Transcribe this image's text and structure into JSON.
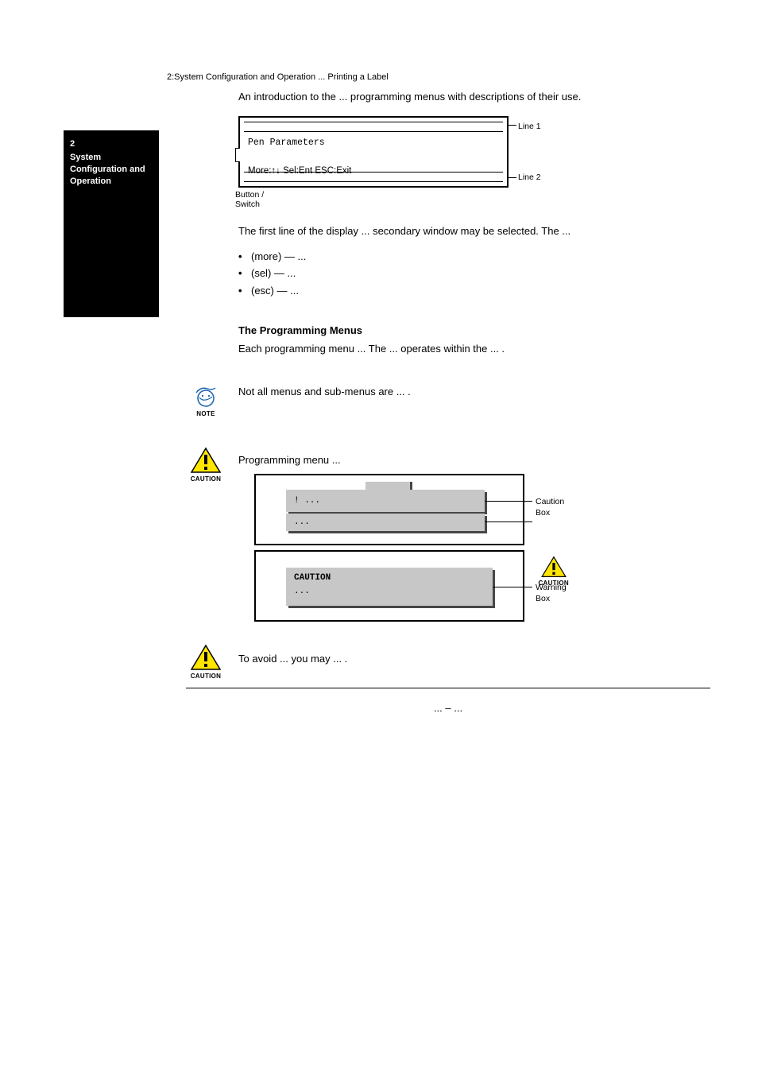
{
  "header_path": "2:System Configuration and Operation ... Printing a Label",
  "side_tab": {
    "line1": "2",
    "line2": "System Configuration and Operation"
  },
  "intro": "An introduction to the ... programming menus with descriptions of their use.",
  "lcd1": {
    "top_text": "Pen Parameters",
    "bottom_text": "More:↑↓  Sel:Ent  ESC:Exit",
    "callout_top": "Line 1",
    "callout_bottom": "Line 2",
    "callout_left": "Button / Switch"
  },
  "p_firstline": "The first line of the display ... secondary window may be selected. The ...",
  "bullet1": "(more) — ...",
  "bullet2": "(sel) — ...",
  "bullet3": "(esc) — ...",
  "menus": {
    "heading": "The Programming Menus",
    "body": "Each programming menu ... The ... operates within the ... ."
  },
  "note_text": "Not all menus and sub-menus are ... .",
  "caution_block": {
    "intro": "Programming menu ...",
    "panel1": {
      "line1": "! ...",
      "line2": "...",
      "label": "Caution Box"
    },
    "panel2": {
      "line1": "CAUTION",
      "line2": "...",
      "label": "Warning Box"
    }
  },
  "caution2_text": "To avoid ... you may ... .",
  "footer_page": "... – ..."
}
